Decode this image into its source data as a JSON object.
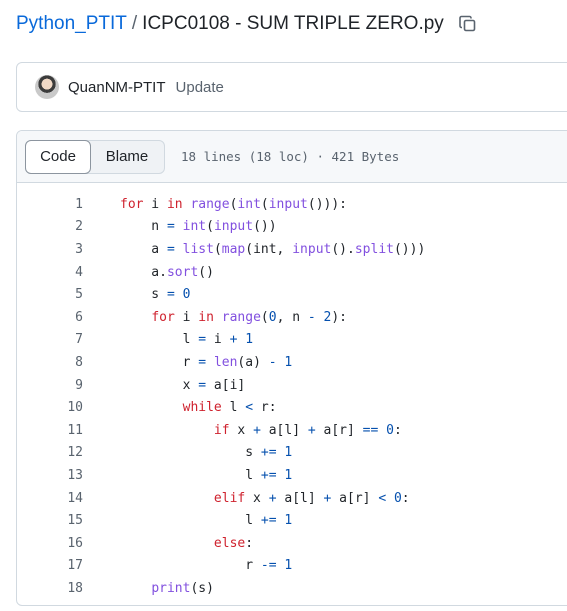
{
  "breadcrumb": {
    "repo": "Python_PTIT",
    "separator": "/",
    "file": "ICPC0108 - SUM TRIPLE ZERO.py"
  },
  "commit": {
    "author": "QuanNM-PTIT",
    "message": "Update"
  },
  "file_header": {
    "code_tab": "Code",
    "blame_tab": "Blame",
    "meta": "18 lines (18 loc) · 421 Bytes"
  },
  "code": {
    "lines": [
      [
        [
          "kw",
          "for"
        ],
        [
          "t",
          " i "
        ],
        [
          "kw",
          "in"
        ],
        [
          "t",
          " "
        ],
        [
          "fn",
          "range"
        ],
        [
          "t",
          "("
        ],
        [
          "fn",
          "int"
        ],
        [
          "t",
          "("
        ],
        [
          "fn",
          "input"
        ],
        [
          "t",
          "())):"
        ]
      ],
      [
        [
          "t",
          "    n "
        ],
        [
          "op",
          "="
        ],
        [
          "t",
          " "
        ],
        [
          "fn",
          "int"
        ],
        [
          "t",
          "("
        ],
        [
          "fn",
          "input"
        ],
        [
          "t",
          "())"
        ]
      ],
      [
        [
          "t",
          "    a "
        ],
        [
          "op",
          "="
        ],
        [
          "t",
          " "
        ],
        [
          "fn",
          "list"
        ],
        [
          "t",
          "("
        ],
        [
          "fn",
          "map"
        ],
        [
          "t",
          "(int, "
        ],
        [
          "fn",
          "input"
        ],
        [
          "t",
          "()."
        ],
        [
          "fn",
          "split"
        ],
        [
          "t",
          "()))"
        ]
      ],
      [
        [
          "t",
          "    a."
        ],
        [
          "fn",
          "sort"
        ],
        [
          "t",
          "()"
        ]
      ],
      [
        [
          "t",
          "    s "
        ],
        [
          "op",
          "="
        ],
        [
          "t",
          " "
        ],
        [
          "num",
          "0"
        ]
      ],
      [
        [
          "t",
          "    "
        ],
        [
          "kw",
          "for"
        ],
        [
          "t",
          " i "
        ],
        [
          "kw",
          "in"
        ],
        [
          "t",
          " "
        ],
        [
          "fn",
          "range"
        ],
        [
          "t",
          "("
        ],
        [
          "num",
          "0"
        ],
        [
          "t",
          ", n "
        ],
        [
          "op",
          "-"
        ],
        [
          "t",
          " "
        ],
        [
          "num",
          "2"
        ],
        [
          "t",
          "):"
        ]
      ],
      [
        [
          "t",
          "        l "
        ],
        [
          "op",
          "="
        ],
        [
          "t",
          " i "
        ],
        [
          "op",
          "+"
        ],
        [
          "t",
          " "
        ],
        [
          "num",
          "1"
        ]
      ],
      [
        [
          "t",
          "        r "
        ],
        [
          "op",
          "="
        ],
        [
          "t",
          " "
        ],
        [
          "fn",
          "len"
        ],
        [
          "t",
          "(a) "
        ],
        [
          "op",
          "-"
        ],
        [
          "t",
          " "
        ],
        [
          "num",
          "1"
        ]
      ],
      [
        [
          "t",
          "        x "
        ],
        [
          "op",
          "="
        ],
        [
          "t",
          " a[i]"
        ]
      ],
      [
        [
          "t",
          "        "
        ],
        [
          "kw",
          "while"
        ],
        [
          "t",
          " l "
        ],
        [
          "op",
          "<"
        ],
        [
          "t",
          " r:"
        ]
      ],
      [
        [
          "t",
          "            "
        ],
        [
          "kw",
          "if"
        ],
        [
          "t",
          " x "
        ],
        [
          "op",
          "+"
        ],
        [
          "t",
          " a[l] "
        ],
        [
          "op",
          "+"
        ],
        [
          "t",
          " a[r] "
        ],
        [
          "op",
          "=="
        ],
        [
          "t",
          " "
        ],
        [
          "num",
          "0"
        ],
        [
          "t",
          ":"
        ]
      ],
      [
        [
          "t",
          "                s "
        ],
        [
          "op",
          "+="
        ],
        [
          "t",
          " "
        ],
        [
          "num",
          "1"
        ]
      ],
      [
        [
          "t",
          "                l "
        ],
        [
          "op",
          "+="
        ],
        [
          "t",
          " "
        ],
        [
          "num",
          "1"
        ]
      ],
      [
        [
          "t",
          "            "
        ],
        [
          "kw",
          "elif"
        ],
        [
          "t",
          " x "
        ],
        [
          "op",
          "+"
        ],
        [
          "t",
          " a[l] "
        ],
        [
          "op",
          "+"
        ],
        [
          "t",
          " a[r] "
        ],
        [
          "op",
          "<"
        ],
        [
          "t",
          " "
        ],
        [
          "num",
          "0"
        ],
        [
          "t",
          ":"
        ]
      ],
      [
        [
          "t",
          "                l "
        ],
        [
          "op",
          "+="
        ],
        [
          "t",
          " "
        ],
        [
          "num",
          "1"
        ]
      ],
      [
        [
          "t",
          "            "
        ],
        [
          "kw",
          "else"
        ],
        [
          "t",
          ":"
        ]
      ],
      [
        [
          "t",
          "                r "
        ],
        [
          "op",
          "-="
        ],
        [
          "t",
          " "
        ],
        [
          "num",
          "1"
        ]
      ],
      [
        [
          "t",
          "    "
        ],
        [
          "fn",
          "print"
        ],
        [
          "t",
          "(s)"
        ]
      ]
    ]
  }
}
